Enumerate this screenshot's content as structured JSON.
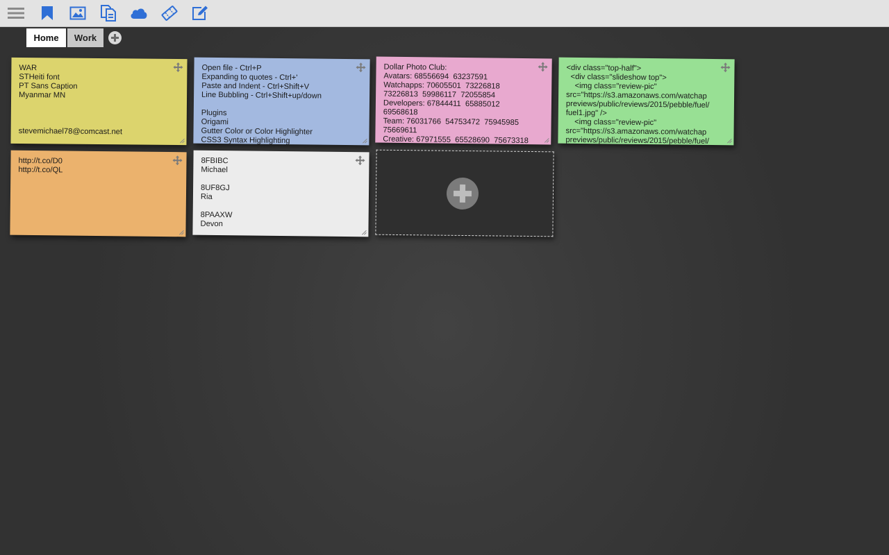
{
  "toolbar": {
    "icons": [
      "menu-icon",
      "bookmark-icon",
      "image-icon",
      "documents-icon",
      "cloud-icon",
      "ticket-icon",
      "edit-icon"
    ],
    "accent_color": "#2f6fd6"
  },
  "tabs": [
    {
      "label": "Home",
      "active": true
    },
    {
      "label": "Work",
      "active": false
    }
  ],
  "notes": [
    {
      "color": "#dcd46d",
      "text": "WAR\nSTHeiti font\nPT Sans Caption\nMyanmar MN\n\n\n\nstevemichael78@comcast.net"
    },
    {
      "color": "#a3b9e0",
      "text": "Open file - Ctrl+P\nExpanding to quotes - Ctrl+'\nPaste and Indent - Ctrl+Shift+V\nLine Bubbling - Ctrl+Shift+up/down\n\nPlugins\nOrigami\nGutter Color or Color Highlighter\nCSS3 Syntax Highlighting"
    },
    {
      "color": "#e8a9cf",
      "text": "Dollar Photo Club:\nAvatars: 68556694  63237591\nWatchapps: 70605501  73226818\n73226813  59986117  72055854\nDevelopers: 67844411  65885012\n69568618\nTeam: 76031766  54753472  75945985\n75669611\nCreative: 67971555  65528690  75673318"
    },
    {
      "color": "#98e094",
      "text": "<div class=\"top-half\">\n  <div class=\"slideshow top\">\n    <img class=\"review-pic\"\nsrc=\"https://s3.amazonaws.com/watchap\npreviews/public/reviews/2015/pebble/fuel/\nfuel1.jpg\" />\n    <img class=\"review-pic\"\nsrc=\"https://s3.amazonaws.com/watchap\npreviews/public/reviews/2015/pebble/fuel/"
    },
    {
      "color": "#ebb26d",
      "text": "http://t.co/D0\nhttp://t.co/QL"
    },
    {
      "color": "#ececec",
      "text": "8FBIBC\nMichael\n\n8UF8GJ\nRia\n\n8PAAXW\nDevon"
    }
  ]
}
